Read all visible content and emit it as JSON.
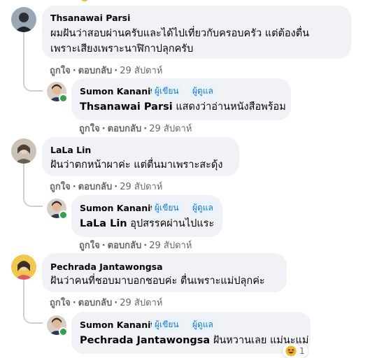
{
  "colors": {
    "bubble": "#f0f2f5",
    "badge_bg": "#e7f3ff",
    "badge_text": "#1b74e4",
    "meta_text": "#65676b",
    "online": "#31a24c"
  },
  "comments": [
    {
      "author": "Thsanawai Parsi",
      "lines": [
        "ผมฝันว่าสอบผ่านครับและได้ไปเที่ยวกับครอบครัว แต่ต้องตื่น",
        "เพราะเสียงเพราะนาฬิกาปลุกครับ"
      ],
      "like": "ถูกใจ",
      "reply": "ตอบกลับ",
      "time": "29 สัปดาห์",
      "avatar_icon": "user-avatar-icon",
      "reply_item": {
        "author": "Sumon Kananit",
        "badges": [
          "ผู้เขียน",
          "ผู้ดูแล"
        ],
        "mention": "Thsanawai Parsi",
        "text": "แสดงว่าอ่านหนังสือพร้อม",
        "like": "ถูกใจ",
        "reply": "ตอบกลับ",
        "time": "29 สัปดาห์"
      }
    },
    {
      "author": "LaLa Lin",
      "lines": [
        "ฝันว่าตกหน้าผาค่ะ แต่ตื่นมาเพราะสะดุ้ง"
      ],
      "like": "ถูกใจ",
      "reply": "ตอบกลับ",
      "time": "29 สัปดาห์",
      "avatar_icon": "user-avatar-icon",
      "reply_item": {
        "author": "Sumon Kananit",
        "badges": [
          "ผู้เขียน",
          "ผู้ดูแล"
        ],
        "mention": "LaLa Lin",
        "text": "อุปสรรคผ่านไปแระ",
        "like": "ถูกใจ",
        "reply": "ตอบกลับ",
        "time": "29 สัปดาห์"
      }
    },
    {
      "author": "Pechrada Jantawongsa",
      "lines": [
        "ฝันว่าคนที่ชอบมาบอกชอบค่ะ ตื่นเพราะแม่ปลุกค่ะ"
      ],
      "like": "ถูกใจ",
      "reply": "ตอบกลับ",
      "time": "29 สัปดาห์",
      "avatar_icon": "user-avatar-icon",
      "reply_item": {
        "author": "Sumon Kananit",
        "badges": [
          "ผู้เขียน",
          "ผู้ดูแล"
        ],
        "mention": "Pechrada Jantawongsa",
        "text": "ฝันหวานเลย แม่นะแม่",
        "reaction_icon": "laughing-emoji-icon",
        "reaction_count": "1"
      }
    }
  ]
}
